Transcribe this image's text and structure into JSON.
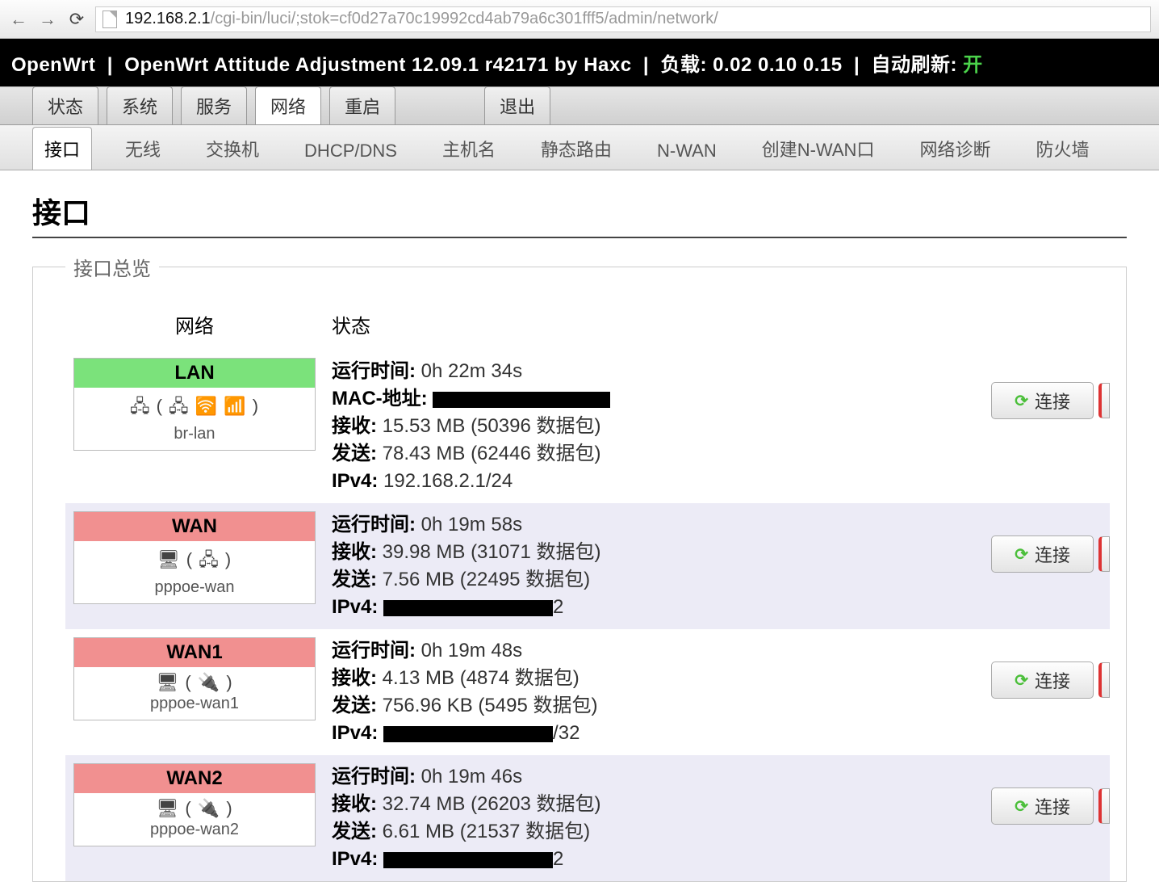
{
  "browser": {
    "url_host": "192.168.2.1",
    "url_path": "/cgi-bin/luci/;stok=cf0d27a70c19992cd4ab79a6c301fff5/admin/network/"
  },
  "header": {
    "hostname": "OpenWrt",
    "firmware": "OpenWrt Attitude Adjustment 12.09.1 r42171 by Haxc",
    "load_label": "负载:",
    "load_values": "0.02 0.10 0.15",
    "autorefresh_label": "自动刷新:",
    "autorefresh_state": "开"
  },
  "toptabs": {
    "items": [
      "状态",
      "系统",
      "服务",
      "网络",
      "重启",
      "退出"
    ],
    "active": 3
  },
  "subtabs": {
    "items": [
      "接口",
      "无线",
      "交换机",
      "DHCP/DNS",
      "主机名",
      "静态路由",
      "N-WAN",
      "创建N-WAN口",
      "网络诊断",
      "防火墙"
    ],
    "active": 0
  },
  "page_title": "接口",
  "overview_legend": "接口总览",
  "col_headers": {
    "network": "网络",
    "status": "状态"
  },
  "labels": {
    "uptime": "运行时间:",
    "mac": "MAC-地址:",
    "rx": "接收:",
    "tx": "发送:",
    "ipv4": "IPv4:",
    "pkts_suffix": " 数据包)",
    "connect_btn": "连接"
  },
  "interfaces": [
    {
      "name": "LAN",
      "color": "green",
      "dev": "br-lan",
      "icons": "🖧 ( 🖧 🛜 📶 )",
      "uptime": "0h 22m 34s",
      "mac_redacted": true,
      "rx": "15.53 MB (50396",
      "tx": "78.43 MB (62446",
      "ipv4": "192.168.2.1/24",
      "ipv4_redacted": false,
      "alt": false
    },
    {
      "name": "WAN",
      "color": "red",
      "dev": "pppoe-wan",
      "icons": "🖥 ( 🖧 )",
      "uptime": "0h 19m 58s",
      "mac_redacted": false,
      "rx": "39.98 MB (31071",
      "tx": "7.56 MB (22495",
      "ipv4_suffix": "2",
      "ipv4_redacted": true,
      "alt": true
    },
    {
      "name": "WAN1",
      "color": "red",
      "dev": "pppoe-wan1",
      "icons": "🖥 ( 🔌 )",
      "uptime": "0h 19m 48s",
      "mac_redacted": false,
      "rx": "4.13 MB (4874",
      "tx": "756.96 KB (5495",
      "ipv4_suffix": "/32",
      "ipv4_redacted": true,
      "alt": false
    },
    {
      "name": "WAN2",
      "color": "red",
      "dev": "pppoe-wan2",
      "icons": "🖥 ( 🔌 )",
      "uptime": "0h 19m 46s",
      "mac_redacted": false,
      "rx": "32.74 MB (26203",
      "tx": "6.61 MB (21537",
      "ipv4_suffix": "2",
      "ipv4_redacted": true,
      "alt": true
    }
  ]
}
